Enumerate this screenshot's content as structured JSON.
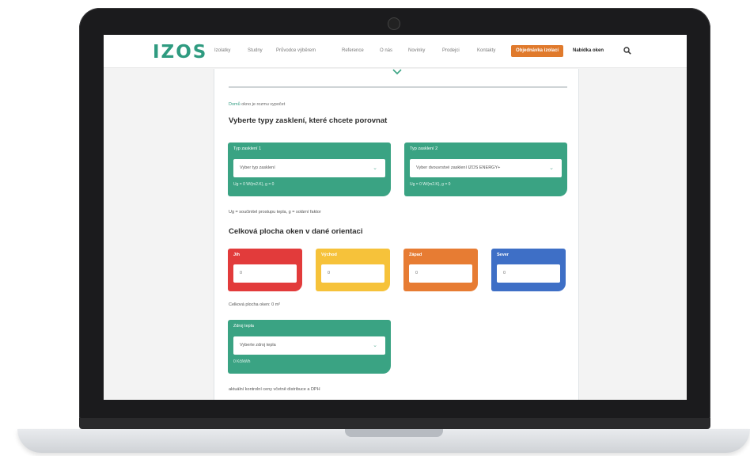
{
  "nav": {
    "logo": "IZOS",
    "items": [
      "Izolatky",
      "Studny",
      "Průvodce výběrem",
      "Reference",
      "O nás",
      "Novinky",
      "Prodejci",
      "Kontakty"
    ],
    "cta_label": "Objednávka izolací",
    "strong_label": "Nabídka oken"
  },
  "crumb": {
    "link": "Domů",
    "rest": "okno je rozmu vypočet"
  },
  "section1": {
    "title": "Vyberte typy zasklení, které chcete porovnat",
    "card1": {
      "label": "Typ zasklení 1",
      "placeholder": "Vyber typ zasklení",
      "meta": "Ug = 0 W/(m2.K), g = 0"
    },
    "card2": {
      "label": "Typ zasklení 2",
      "placeholder": "Vyber dvouvrstvé zasklení IZOS ENERGY+",
      "meta": "Ug = 0 W/(m2.K), g = 0"
    },
    "note": "Ug = součinitel prostupu tepla, g = solární faktor"
  },
  "section2": {
    "title": "Celková plocha oken v dané orientaci",
    "orientations": [
      {
        "label": "Jih",
        "value": "0",
        "color": "#e23b3b"
      },
      {
        "label": "Východ",
        "value": "0",
        "color": "#f6c23a"
      },
      {
        "label": "Západ",
        "value": "0",
        "color": "#e77c33"
      },
      {
        "label": "Sever",
        "value": "0",
        "color": "#3e6fc6"
      }
    ],
    "total_note": "Celková plocha oken: 0 m²"
  },
  "section3": {
    "card": {
      "label": "Zdroj tepla",
      "placeholder": "Vyberte zdroj tepla",
      "meta": "0 Kč/kWh"
    },
    "note": "aktuální kontrolní ceny včetně distribuce a DPH"
  },
  "colors": {
    "brand": "#2f9b80",
    "card_green": "#3aa383",
    "cta": "#e07a2c"
  }
}
